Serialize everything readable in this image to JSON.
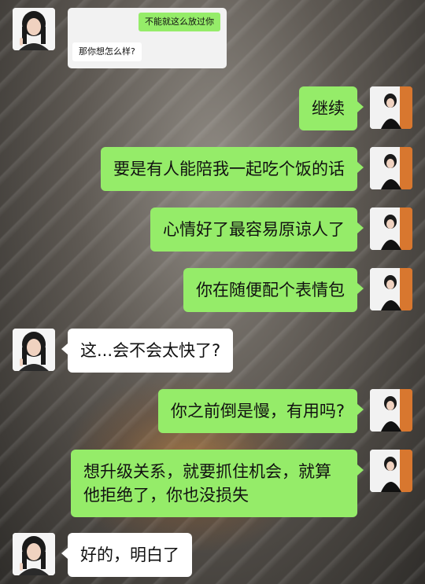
{
  "conversation": {
    "quoted": {
      "sent": "不能就这么放过你",
      "received": "那你想怎么样?"
    },
    "messages": [
      {
        "side": "right",
        "text": "继续"
      },
      {
        "side": "right",
        "text": "要是有人能陪我一起吃个饭的话"
      },
      {
        "side": "right",
        "text": "心情好了最容易原谅人了"
      },
      {
        "side": "right",
        "text": "你在随便配个表情包"
      },
      {
        "side": "left",
        "text": "这...会不会太快了?"
      },
      {
        "side": "right",
        "text": "你之前倒是慢，有用吗?"
      },
      {
        "side": "right",
        "text": "想升级关系，就要抓住机会，就算他拒绝了，你也没损失"
      },
      {
        "side": "left",
        "text": "好的，明白了"
      }
    ]
  },
  "colors": {
    "sent_bubble": "#95ec69",
    "received_bubble": "#ffffff"
  }
}
